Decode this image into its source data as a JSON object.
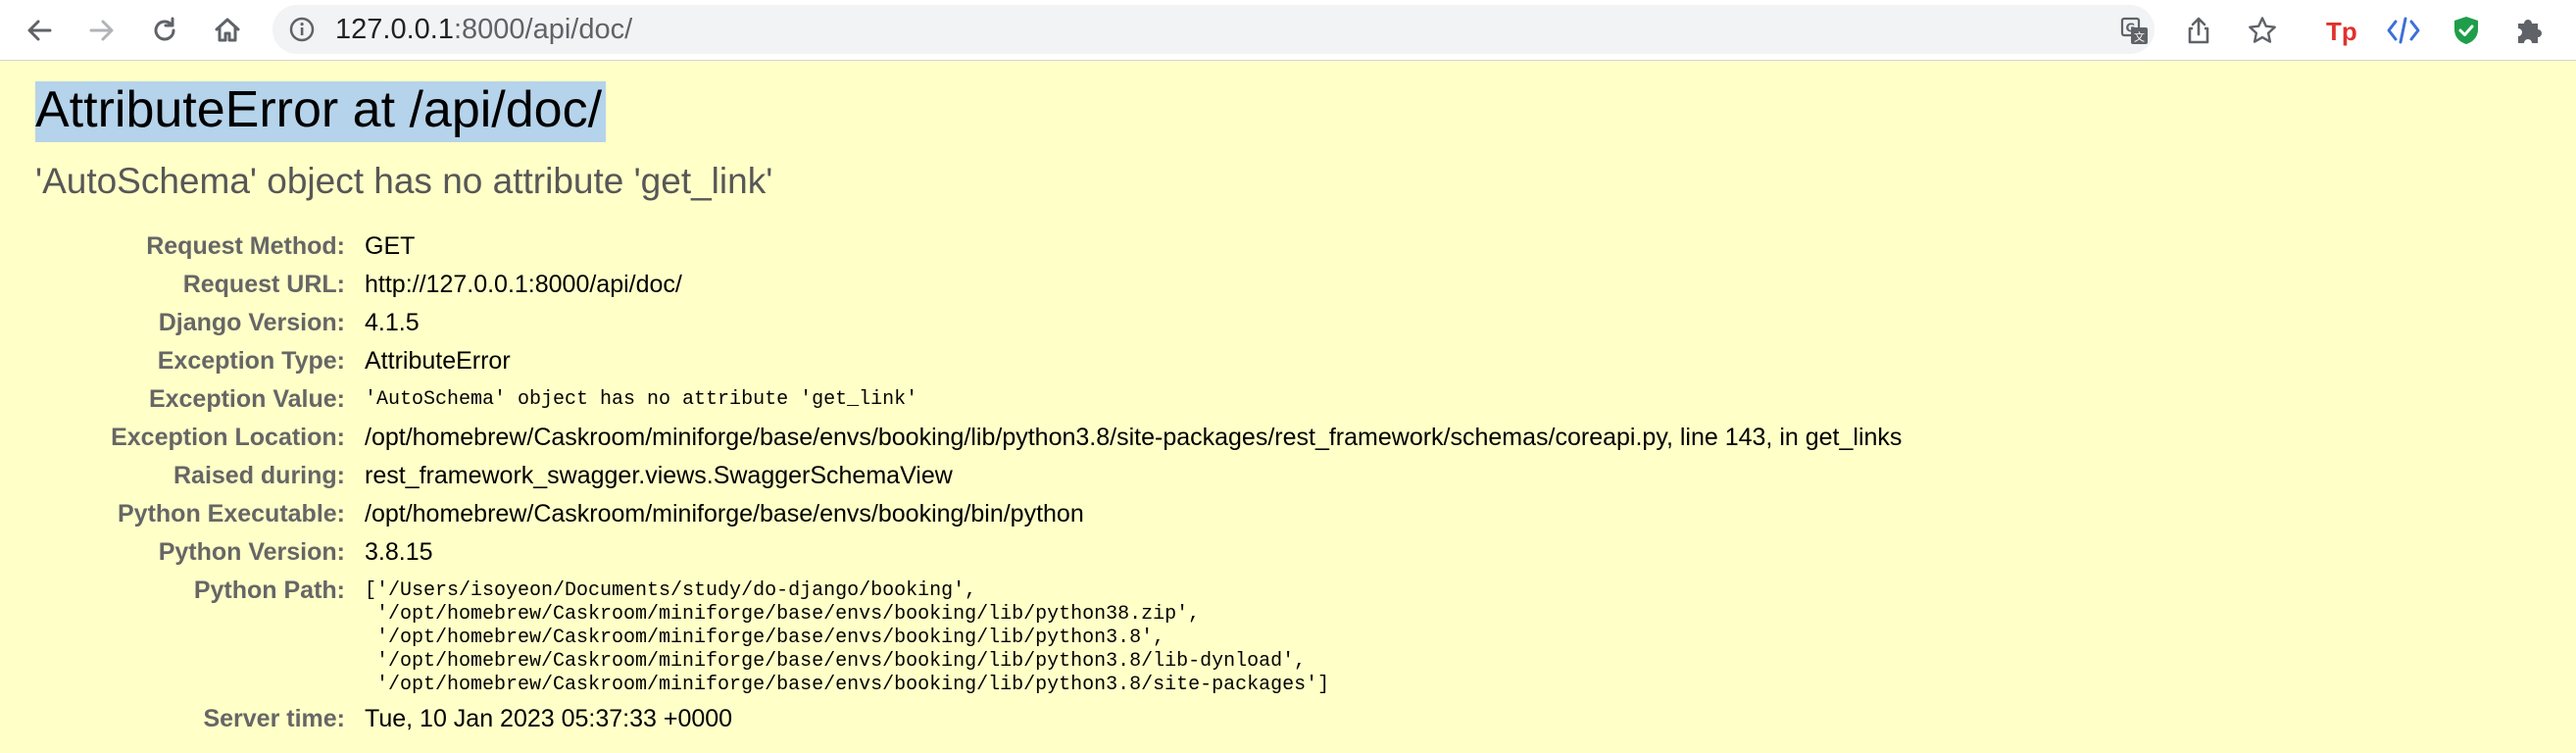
{
  "browser": {
    "url_host": "127.0.0.1",
    "url_rest": ":8000/api/doc/"
  },
  "error": {
    "title": "AttributeError at /api/doc/",
    "subtitle": "'AutoSchema' object has no attribute 'get_link'"
  },
  "meta": {
    "request_method": {
      "label": "Request Method:",
      "value": "GET"
    },
    "request_url": {
      "label": "Request URL:",
      "value": "http://127.0.0.1:8000/api/doc/"
    },
    "django_version": {
      "label": "Django Version:",
      "value": "4.1.5"
    },
    "exception_type": {
      "label": "Exception Type:",
      "value": "AttributeError"
    },
    "exception_value": {
      "label": "Exception Value:",
      "value": "'AutoSchema' object has no attribute 'get_link'"
    },
    "exception_location": {
      "label": "Exception Location:",
      "value": "/opt/homebrew/Caskroom/miniforge/base/envs/booking/lib/python3.8/site-packages/rest_framework/schemas/coreapi.py, line 143, in get_links"
    },
    "raised_during": {
      "label": "Raised during:",
      "value": "rest_framework_swagger.views.SwaggerSchemaView"
    },
    "python_executable": {
      "label": "Python Executable:",
      "value": "/opt/homebrew/Caskroom/miniforge/base/envs/booking/bin/python"
    },
    "python_version": {
      "label": "Python Version:",
      "value": "3.8.15"
    },
    "python_path": {
      "label": "Python Path:",
      "value": "['/Users/isoyeon/Documents/study/do-django/booking',\n '/opt/homebrew/Caskroom/miniforge/base/envs/booking/lib/python38.zip',\n '/opt/homebrew/Caskroom/miniforge/base/envs/booking/lib/python3.8',\n '/opt/homebrew/Caskroom/miniforge/base/envs/booking/lib/python3.8/lib-dynload',\n '/opt/homebrew/Caskroom/miniforge/base/envs/booking/lib/python3.8/site-packages']"
    },
    "server_time": {
      "label": "Server time:",
      "value": "Tue, 10 Jan 2023 05:37:33 +0000"
    }
  },
  "colors": {
    "page_background": "#ffffc8",
    "selection_highlight": "#b5d3ea",
    "label_gray": "#666666",
    "extension_tp_red": "#e0322d",
    "extension_shield_green": "#1e9e4a"
  },
  "icons": {
    "back": "arrow-left-icon",
    "forward": "arrow-right-icon",
    "reload": "reload-icon",
    "home": "home-icon",
    "site_info": "info-circle-icon",
    "translate": "translate-icon",
    "share": "share-icon",
    "bookmark": "star-icon",
    "ext_tp": "tp-extension-icon",
    "ext_code": "code-extension-icon",
    "ext_shield": "shield-check-icon",
    "extensions": "puzzle-icon"
  }
}
